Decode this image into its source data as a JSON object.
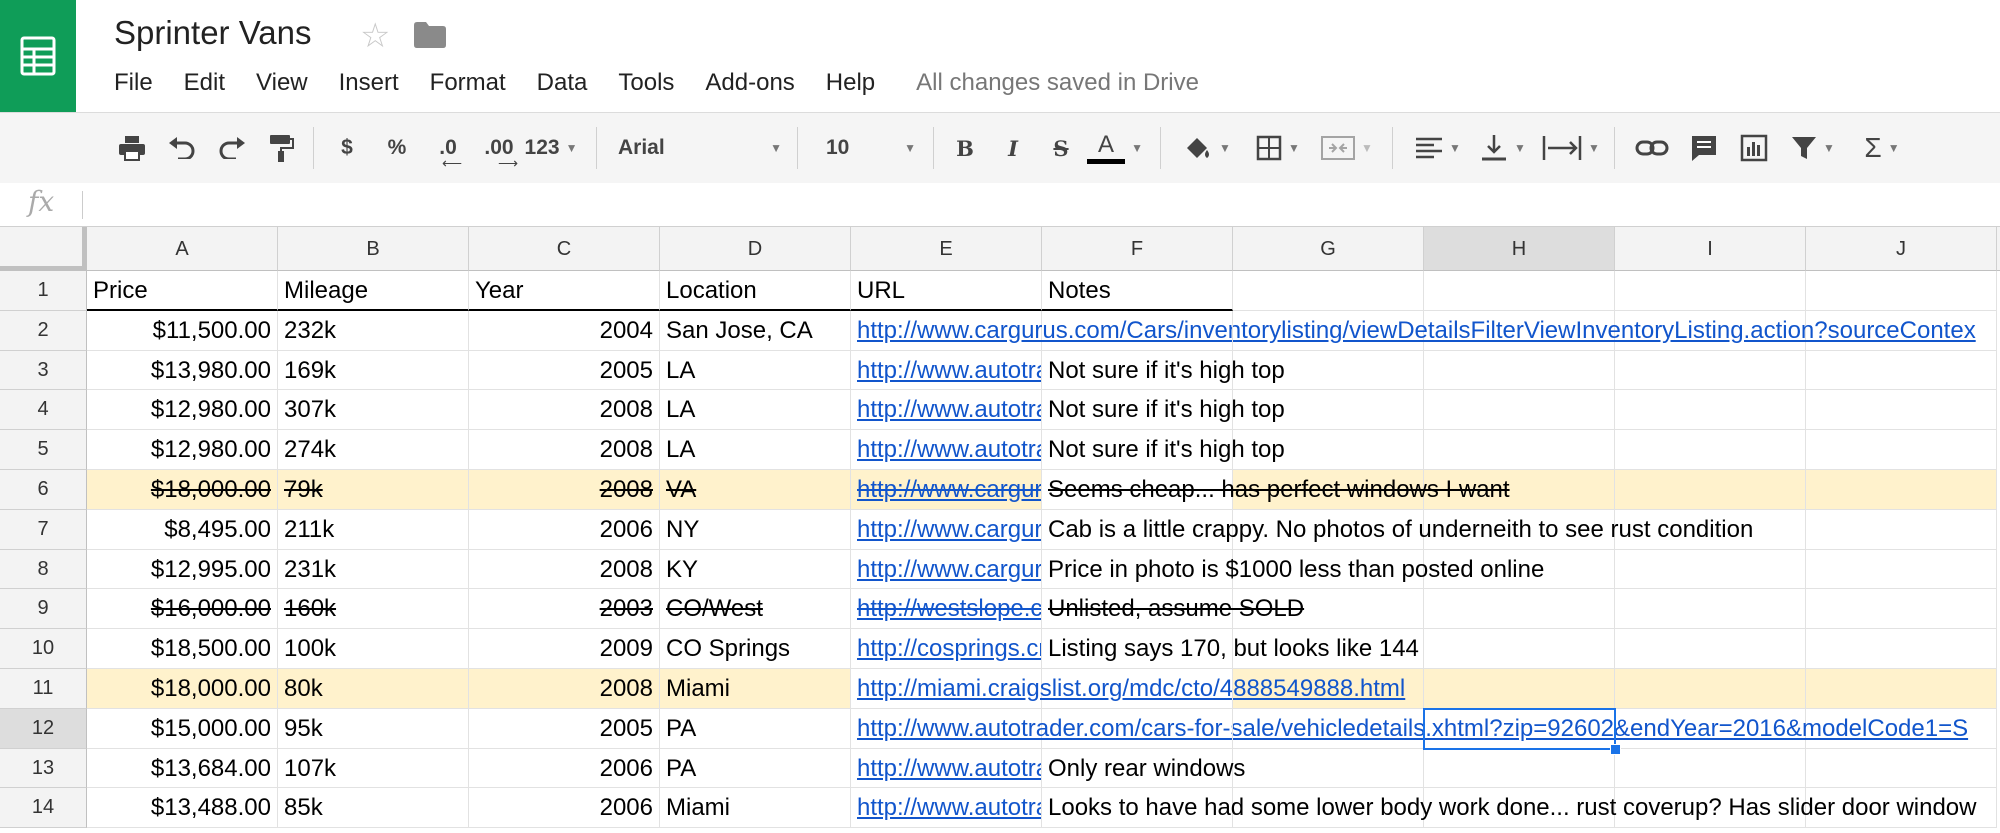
{
  "app": {
    "title": "Sprinter Vans",
    "saved_status": "All changes saved in Drive",
    "menu": [
      "File",
      "Edit",
      "View",
      "Insert",
      "Format",
      "Data",
      "Tools",
      "Add-ons",
      "Help"
    ]
  },
  "toolbar": {
    "currency": "$",
    "percent": "%",
    "decrease_decimal": ".0",
    "increase_decimal": ".00",
    "more_formats": "123",
    "font": "Arial",
    "font_size": "10",
    "bold": "B",
    "italic": "I",
    "strikethrough": "S",
    "text_color": "A"
  },
  "formula_bar": {
    "label": "fx",
    "value": ""
  },
  "colors": {
    "brand_green": "#0f9d58",
    "highlight": "#fff2cc",
    "link": "#1155cc",
    "selection": "#1a73e8"
  },
  "sheet": {
    "columns": [
      "A",
      "B",
      "C",
      "D",
      "E",
      "F",
      "G",
      "H",
      "I",
      "J"
    ],
    "selected_column": "H",
    "selected_row": 12,
    "header": [
      "Price",
      "Mileage",
      "Year",
      "Location",
      "URL",
      "Notes"
    ],
    "rows": [
      {
        "n": "2",
        "price": "$11,500.00",
        "mileage": "232k",
        "year": "2004",
        "location": "San Jose, CA",
        "url": "http://www.cargurus.com/Cars/inventorylisting/viewDetailsFilterViewInventoryListing.action?sourceContex",
        "notes": "",
        "highlight": false,
        "strike": false,
        "url_overflow": true
      },
      {
        "n": "3",
        "price": "$13,980.00",
        "mileage": "169k",
        "year": "2005",
        "location": "LA",
        "url": "http://www.autotrader.com",
        "notes": "Not sure if it's high top",
        "highlight": false,
        "strike": false,
        "url_overflow": false
      },
      {
        "n": "4",
        "price": "$12,980.00",
        "mileage": "307k",
        "year": "2008",
        "location": "LA",
        "url": "http://www.autotrader.com",
        "notes": "Not sure if it's high top",
        "highlight": false,
        "strike": false,
        "url_overflow": false
      },
      {
        "n": "5",
        "price": "$12,980.00",
        "mileage": "274k",
        "year": "2008",
        "location": "LA",
        "url": "http://www.autotrader.com",
        "notes": "Not sure if it's high top",
        "highlight": false,
        "strike": false,
        "url_overflow": false
      },
      {
        "n": "6",
        "price": "$18,000.00",
        "mileage": "79k",
        "year": "2008",
        "location": "VA",
        "url": "http://www.cargurus.com",
        "notes": "Seems cheap... has perfect windows I want",
        "highlight": true,
        "strike": true,
        "url_overflow": false
      },
      {
        "n": "7",
        "price": "$8,495.00",
        "mileage": "211k",
        "year": "2006",
        "location": "NY",
        "url": "http://www.cargurus.com",
        "notes": "Cab is a little crappy. No photos of underneith to see rust condition",
        "highlight": false,
        "strike": false,
        "url_overflow": false
      },
      {
        "n": "8",
        "price": "$12,995.00",
        "mileage": "231k",
        "year": "2008",
        "location": "KY",
        "url": "http://www.cargurus.com",
        "notes": "Price in photo is $1000 less than posted online",
        "highlight": false,
        "strike": false,
        "url_overflow": false
      },
      {
        "n": "9",
        "price": "$16,000.00",
        "mileage": "160k",
        "year": "2003",
        "location": "CO/West",
        "url": "http://westslope.craigslist.org",
        "notes": "Unlisted, assume SOLD",
        "highlight": false,
        "strike": true,
        "url_overflow": false
      },
      {
        "n": "10",
        "price": "$18,500.00",
        "mileage": "100k",
        "year": "2009",
        "location": "CO Springs",
        "url": "http://cosprings.craigslist.org",
        "notes": "Listing says 170, but looks like 144",
        "highlight": false,
        "strike": false,
        "url_overflow": false
      },
      {
        "n": "11",
        "price": "$18,000.00",
        "mileage": "80k",
        "year": "2008",
        "location": "Miami",
        "url": "http://miami.craigslist.org/mdc/cto/4888549888.html",
        "notes": "",
        "highlight": true,
        "strike": false,
        "url_overflow": true
      },
      {
        "n": "12",
        "price": "$15,000.00",
        "mileage": "95k",
        "year": "2005",
        "location": "PA",
        "url": "http://www.autotrader.com/cars-for-sale/vehicledetails.xhtml?zip=92602&endYear=2016&modelCode1=S",
        "notes": "",
        "highlight": false,
        "strike": false,
        "url_overflow": true
      },
      {
        "n": "13",
        "price": "$13,684.00",
        "mileage": "107k",
        "year": "2006",
        "location": "PA",
        "url": "http://www.autotrader.com",
        "notes": "Only rear windows",
        "highlight": false,
        "strike": false,
        "url_overflow": false
      },
      {
        "n": "14",
        "price": "$13,488.00",
        "mileage": "85k",
        "year": "2006",
        "location": "Miami",
        "url": "http://www.autotrader.com",
        "notes": "Looks to have had some lower body work done... rust coverup? Has slider door window",
        "highlight": false,
        "strike": false,
        "url_overflow": false
      }
    ]
  }
}
